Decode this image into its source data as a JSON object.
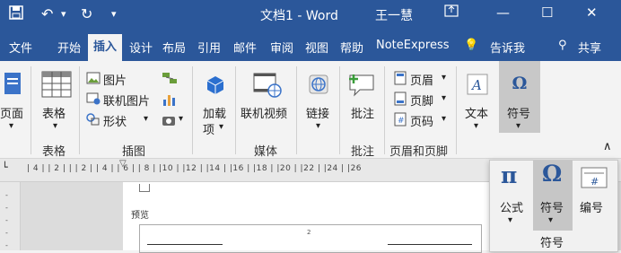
{
  "window": {
    "title": "文档1  -  Word",
    "user": "王一慧"
  },
  "quick_access": {
    "save_icon": "save-icon",
    "undo_icon": "undo-icon",
    "redo_icon": "redo-icon"
  },
  "tabs": [
    "文件",
    "开始",
    "插入",
    "设计",
    "布局",
    "引用",
    "邮件",
    "审阅",
    "视图",
    "帮助",
    "NoteExpress"
  ],
  "active_tab": "插入",
  "tellme": "告诉我",
  "share": "共享",
  "ribbon": {
    "page": "页面",
    "table": {
      "label": "表格",
      "group": "表格"
    },
    "illustrations": {
      "picture": "图片",
      "online_picture": "联机图片",
      "shapes": "形状",
      "group": "插图"
    },
    "addins": {
      "label1": "加载",
      "label2": "项"
    },
    "media": {
      "online_video": "联机视频",
      "group": "媒体"
    },
    "links": {
      "label": "链接"
    },
    "comments": {
      "label": "批注",
      "group": "批注"
    },
    "header_footer": {
      "header": "页眉",
      "footer": "页脚",
      "page_number": "页码",
      "group": "页眉和页脚"
    },
    "text": {
      "label": "文本"
    },
    "symbols": {
      "label": "符号"
    }
  },
  "ruler": {
    "marks": "| 4 |  | 2 |  |  | 2 |  | 4 |  | 6 |  | 8 |  |10 |  |12 |  |14 |  |16 |  |18 |  |20 |  |22 |  |24 |  |26"
  },
  "document": {
    "section_label": "预览",
    "page_num": "2"
  },
  "symbols_popup": {
    "equation": "公式",
    "symbol": "符号",
    "number": "编号",
    "group": "符号"
  },
  "accent_color": "#2b579a"
}
